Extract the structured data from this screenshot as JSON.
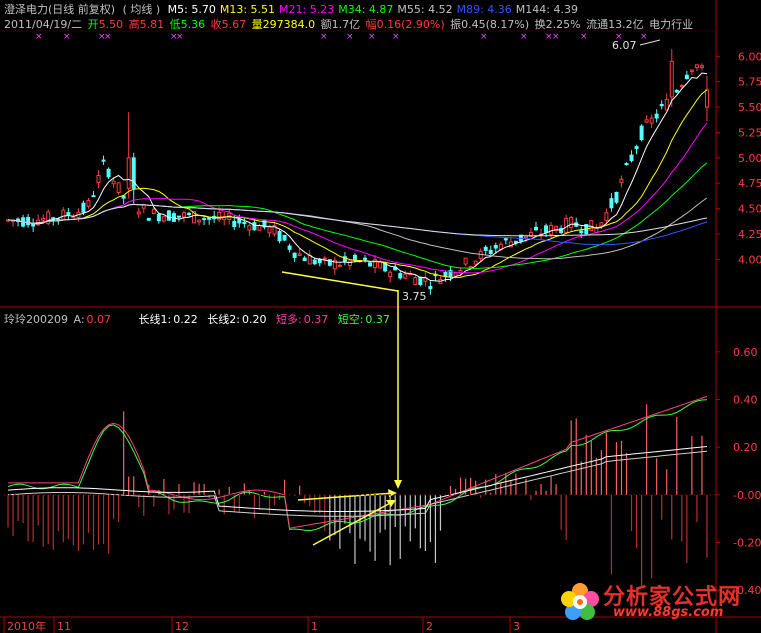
{
  "header1": {
    "stock": "澄泽电力(日线 前复权)",
    "ma_label": "( 均线 )",
    "ma": [
      {
        "label": "M5:",
        "value": "5.70",
        "color": "#ffffff"
      },
      {
        "label": "M13:",
        "value": "5.51",
        "color": "#ffff00"
      },
      {
        "label": "M21:",
        "value": "5.23",
        "color": "#ff00ff"
      },
      {
        "label": "M34:",
        "value": "4.87",
        "color": "#00ff00"
      },
      {
        "label": "M55:",
        "value": "4.52",
        "color": "#c0c0c0"
      },
      {
        "label": "M89:",
        "value": "4.36",
        "color": "#3355ff"
      },
      {
        "label": "M144:",
        "value": "4.39",
        "color": "#c0c0c0"
      }
    ]
  },
  "header2": {
    "date": "2011/04/19/二",
    "open_label": "开",
    "open": "5.50",
    "high_label": "高",
    "high": "5.81",
    "low_label": "低",
    "low": "5.36",
    "close_label": "收",
    "close": "5.67",
    "vol_label": "量",
    "vol": "297384.0",
    "amt_label": "额",
    "amt": "1.7亿",
    "chg_label": "幅",
    "chg": "0.16(2.90%)",
    "amp_label": "振",
    "amp": "0.45(8.17%)",
    "turn_label": "换",
    "turn": "2.25%",
    "float_label": "流通",
    "float": "13.2亿",
    "industry": "电力行业"
  },
  "indicator_header": {
    "name": "玲玲200209",
    "a_label": "A:",
    "a": "0.07",
    "l1_label": "长线1:",
    "l1": "0.22",
    "l2_label": "长线2:",
    "l2": "0.20",
    "sd_label": "短多:",
    "sd": "0.37",
    "sk_label": "短空:",
    "sk": "0.37"
  },
  "price_axis": [
    "6.00",
    "5.75",
    "5.50",
    "5.25",
    "5.00",
    "4.75",
    "4.50",
    "4.25",
    "4.00"
  ],
  "ind_axis": [
    "0.60",
    "0.40",
    "0.20",
    "-0.00",
    "-0.20",
    "-0.40"
  ],
  "x_axis": [
    "2010年",
    "11",
    "12",
    "1",
    "2",
    "3"
  ],
  "annotations": {
    "high_mark": "6.07",
    "low_mark": "3.75"
  },
  "watermark": {
    "cn": "分析家公式网",
    "url": "www.88gs.com"
  },
  "colors": {
    "up": "#ff3b3b",
    "down": "#54ffff",
    "axis": "#b00000",
    "yellow": "#ffff40"
  },
  "chart_data": {
    "type": "candlestick+indicator",
    "price_ylim": [
      3.6,
      6.2
    ],
    "indicator_ylim": [
      -0.5,
      0.7
    ],
    "annotated_low": 3.75,
    "annotated_high": 6.07,
    "last_close": 5.67
  }
}
